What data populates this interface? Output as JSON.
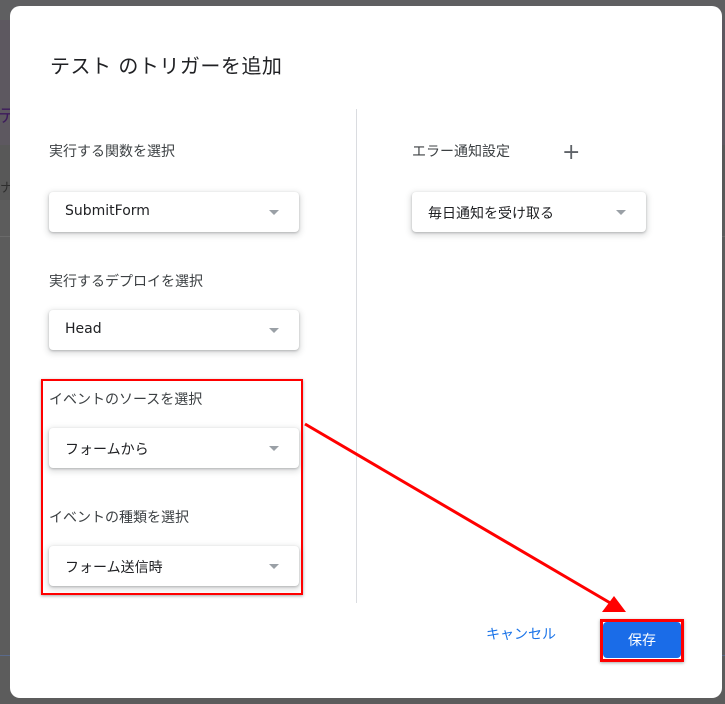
{
  "background": {
    "partial_glyph_1": "テ",
    "partial_glyph_2": "ナ"
  },
  "dialog": {
    "title": "テスト のトリガーを追加",
    "left_column": {
      "fields": [
        {
          "label": "実行する関数を選択",
          "value": "SubmitForm"
        },
        {
          "label": "実行するデプロイを選択",
          "value": "Head"
        },
        {
          "label": "イベントのソースを選択",
          "value": "フォームから"
        },
        {
          "label": "イベントの種類を選択",
          "value": "フォーム送信時"
        }
      ]
    },
    "right_column": {
      "error_notification": {
        "label": "エラー通知設定",
        "add_icon": "plus-icon",
        "value": "毎日通知を受け取る"
      }
    },
    "actions": {
      "cancel_label": "キャンセル",
      "save_label": "保存"
    }
  },
  "annotations": {
    "color": "#ff0000",
    "highlight_event_fields": true,
    "highlight_save_button": true,
    "arrow": "from-event-fields-to-save-button"
  },
  "colors": {
    "primary_button": "#1a6ce8",
    "link": "#1a73e8",
    "annotation": "#ff0000"
  }
}
